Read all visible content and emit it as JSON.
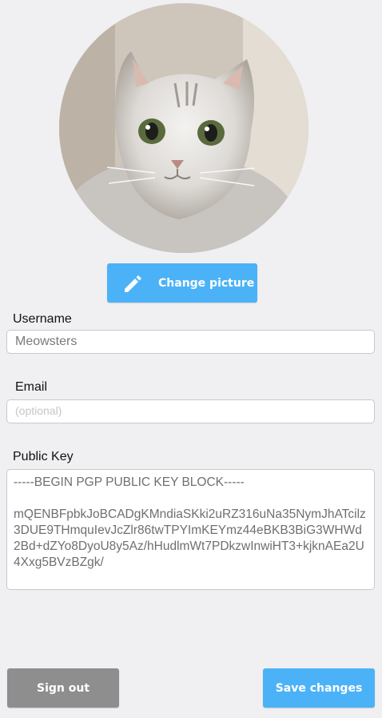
{
  "profile": {
    "avatar_icon": "cat-photo",
    "change_picture_label": "Change picture",
    "change_picture_icon": "pencil-icon"
  },
  "username": {
    "label": "Username",
    "value": "Meowsters"
  },
  "email": {
    "label": "Email",
    "value": "",
    "placeholder": "(optional)"
  },
  "public_key": {
    "label": "Public Key",
    "value": "-----BEGIN PGP PUBLIC KEY BLOCK-----\n\nmQENBFpbkJoBCADgKMndiaSKki2uRZ316uNa35NymJhATcilz3DUE9THmquIevJcZlr86twTPYImKEYmz44eBKB3BiG3WHWd2Bd+dZYo8DyoU8y5Az/hHudlmWt7PDkzwInwiHT3+kjknAEa2U4Xxg5BVzBZgk/"
  },
  "actions": {
    "sign_out_label": "Sign out",
    "save_label": "Save changes"
  },
  "colors": {
    "background": "#f0eff1",
    "accent": "#4cb2f7",
    "secondary_button": "#8e8e8e"
  }
}
